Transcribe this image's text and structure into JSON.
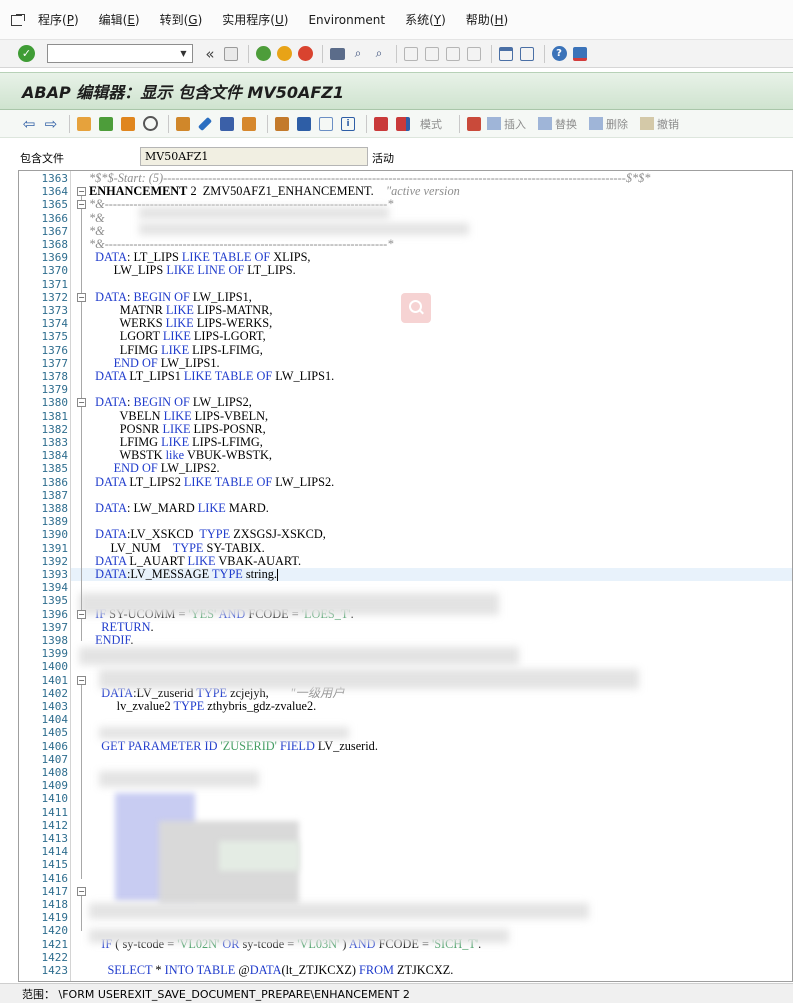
{
  "menu": {
    "items": [
      {
        "label": "程序(",
        "key": "P",
        "suffix": ")"
      },
      {
        "label": "编辑(",
        "key": "E",
        "suffix": ")"
      },
      {
        "label": "转到(",
        "key": "G",
        "suffix": ")"
      },
      {
        "label": "实用程序(",
        "key": "U",
        "suffix": ")"
      },
      {
        "label": "Environment",
        "key": "",
        "suffix": ""
      },
      {
        "label": "系统(",
        "key": "Y",
        "suffix": ")"
      },
      {
        "label": "帮助(",
        "key": "H",
        "suffix": ")"
      }
    ]
  },
  "toolbar": {
    "command_value": "",
    "history_glyph": "«"
  },
  "title": "ABAP 编辑器：显示 包含文件 MV50AFZ1",
  "app_toolbar": {
    "mode_label": "模式",
    "insert_label": "插入",
    "replace_label": "替换",
    "delete_label": "删除",
    "undo_label": "撤销"
  },
  "include": {
    "label": "包含文件",
    "value": "MV50AFZ1",
    "status": "活动"
  },
  "editor": {
    "first_line": 1363,
    "last_line": 1423,
    "lines": {
      "1363": "*$*$-Start: (5)-----------------------------------------------------------------------------------------------------------------$*$*",
      "1364": "ENHANCEMENT 2  ZMV50AFZ1_ENHANCEMENT.    \"active version",
      "1365": "*&---------------------------------------------------------------------*",
      "1366": "*&",
      "1367": "*&",
      "1368": "*&---------------------------------------------------------------------*",
      "1369": "  DATA: LT_LIPS LIKE TABLE OF XLIPS,",
      "1370": "        LW_LIPS LIKE LINE OF LT_LIPS.",
      "1372": "  DATA: BEGIN OF LW_LIPS1,",
      "1373": "          MATNR LIKE LIPS-MATNR,",
      "1374": "          WERKS LIKE LIPS-WERKS,",
      "1375": "          LGORT LIKE LIPS-LGORT,",
      "1376": "          LFIMG LIKE LIPS-LFIMG,",
      "1377": "        END OF LW_LIPS1.",
      "1378": "  DATA LT_LIPS1 LIKE TABLE OF LW_LIPS1.",
      "1380": "  DATA: BEGIN OF LW_LIPS2,",
      "1381": "          VBELN LIKE LIPS-VBELN,",
      "1382": "          POSNR LIKE LIPS-POSNR,",
      "1383": "          LFIMG LIKE LIPS-LFIMG,",
      "1384": "          WBSTK like VBUK-WBSTK,",
      "1385": "        END OF LW_LIPS2.",
      "1386": "  DATA LT_LIPS2 LIKE TABLE OF LW_LIPS2.",
      "1388": "  DATA: LW_MARD LIKE MARD.",
      "1390": "  DATA:LV_XSKCD  TYPE ZXSGSJ-XSKCD,",
      "1391": "       LV_NUM    TYPE SY-TABIX.",
      "1392": "  DATA L_AUART LIKE VBAK-AUART.",
      "1393": "  DATA:LV_MESSAGE TYPE string.",
      "1396": "  IF SY-UCOMM = 'YES' AND FCODE = 'LOES_T'.",
      "1397": "    RETURN.",
      "1398": "  ENDIF.",
      "1402": "    DATA:LV_zuserid TYPE zcjejyh,       \"一级用户",
      "1403": "         lv_zvalue2 TYPE zthybris_gdz-zvalue2.",
      "1406": "    GET PARAMETER ID 'ZUSERID' FIELD LV_zuserid.",
      "1421": "    IF ( sy-tcode = 'VL02N' OR sy-tcode = 'VL03N' ) AND FCODE = 'SICH_T'.",
      "1423": "      SELECT * INTO TABLE @DATA(lt_ZTJKCXZ) FROM ZTJKCXZ."
    }
  },
  "statusbar": {
    "text": "范围： \\FORM USEREXIT_SAVE_DOCUMENT_PREPARE\\ENHANCEMENT 2"
  },
  "colors": {
    "title_bg": "#d6e8d6",
    "keyword": "#1f3bcc",
    "string": "#3f9b5f",
    "comment": "#8d8d8d",
    "line_number": "#2e6d8e"
  }
}
